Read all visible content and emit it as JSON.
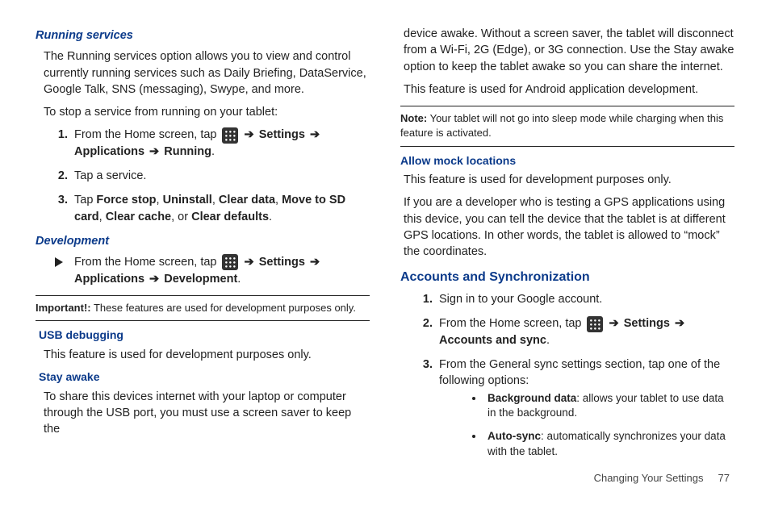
{
  "left": {
    "h1": "Running services",
    "p1": "The Running services option allows you to view and control currently running services such as Daily Briefing, DataService, Google Talk, SNS (messaging), Swype, and more.",
    "p2": "To stop a service from running on your tablet:",
    "step1_a": "From the Home screen, tap ",
    "step1_b": "Settings",
    "step1_c": "Applications",
    "step1_d": "Running",
    "step2": "Tap a service.",
    "step3_a": "Tap ",
    "step3_fs": "Force stop",
    "step3_un": "Uninstall",
    "step3_cd": "Clear data",
    "step3_mv": "Move to SD card",
    "step3_cc": "Clear cache",
    "step3_or": ", or ",
    "step3_df": "Clear defaults",
    "h2": "Development",
    "dev_a": "From the Home screen, tap ",
    "dev_b": "Settings",
    "dev_c": "Applications",
    "dev_d": "Development",
    "imp_lbl": "Important!:",
    "imp_txt": " These features are used for development purposes only.",
    "h3": "USB debugging",
    "p3": "This feature is used for development purposes only.",
    "h4": "Stay awake",
    "p4": "To share this devices internet with your laptop or computer through the USB port, you must use a screen saver to keep the"
  },
  "right": {
    "p1": "device awake. Without a screen saver, the tablet will disconnect from a Wi-Fi, 2G (Edge), or 3G connection. Use the Stay awake option to keep the tablet awake so you can share the internet.",
    "p2": "This feature is used for Android application development.",
    "note_lbl": "Note:",
    "note_txt": " Your tablet will not go into sleep mode while charging when this feature is activated.",
    "h1": "Allow mock locations",
    "p3": "This feature is used for development purposes only.",
    "p4": "If you are a developer who is testing a GPS applications using this device, you can tell the device that the tablet is at different GPS locations. In other words, the tablet is allowed to “mock” the coordinates.",
    "h2": "Accounts and Synchronization",
    "s1": "Sign in to your Google account.",
    "s2_a": "From the Home screen, tap ",
    "s2_b": "Settings",
    "s2_c": "Accounts and sync",
    "s3": "From the General sync settings section, tap one of the following options:",
    "b1_t": "Background data",
    "b1_d": ": allows your tablet to use data in the background.",
    "b2_t": "Auto-sync",
    "b2_d": ": automatically synchronizes your data with the tablet."
  },
  "footer": {
    "label": "Changing Your Settings",
    "page": "77"
  },
  "arrow": "➔"
}
